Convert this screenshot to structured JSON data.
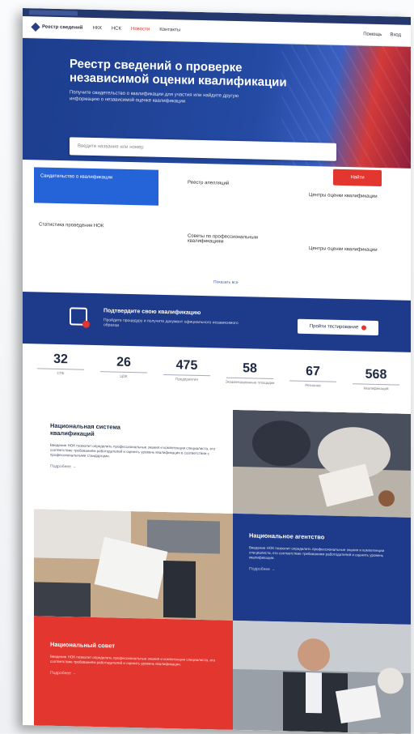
{
  "browser": {
    "tab_label": ""
  },
  "nav": {
    "logo_text": "Реестр сведений",
    "items": [
      "НКК",
      "НСК",
      "Новости",
      "Контакты"
    ],
    "right_items": [
      "Помощь",
      "Вход"
    ]
  },
  "hero": {
    "title": "Реестр сведений о проверке независимой оценки квалификации",
    "subtitle": "Получите свидетельство о квалификации для участия или найдите другую информацию о независимой оценке квалификации",
    "search_placeholder": "Введите название или номер",
    "search_button": "Найти"
  },
  "categories": {
    "items": [
      "Свидетельство о квалификации",
      "Реестр апелляций",
      "Центры оценки квалификации",
      "Статистика проведения НОК",
      "Советы по профессиональным квалификациям",
      "Центры оценки квалификации"
    ],
    "more_link": "Показать все"
  },
  "banner": {
    "title": "Подтвердите свою квалификацию",
    "subtitle": "Пройдите процедуру и получите документ официального независимого образца",
    "button": "Пройти тестирование"
  },
  "stats": [
    {
      "value": "32",
      "label": "СПК"
    },
    {
      "value": "26",
      "label": "ЦОК"
    },
    {
      "value": "475",
      "label": "Предприятия"
    },
    {
      "value": "58",
      "label": "Экзаменационные площадки"
    },
    {
      "value": "67",
      "label": "Регионов"
    },
    {
      "value": "568",
      "label": "Квалификаций"
    }
  ],
  "cards": {
    "nsk": {
      "title": "Национальная система квалификаций",
      "body": "Введение НОК позволит определить профессиональные знания и компетенции специалиста, его соответствие требованиям работодателей и оценить уровень квалификации в соответствии с профессиональными стандартами.",
      "more": "Подробнее →"
    },
    "agency": {
      "title": "Национальное агентство",
      "body": "Введение НОК позволит определить профессиональные знания и компетенции специалиста, его соответствие требованиям работодателей и оценить уровень квалификации.",
      "more": "Подробнее →"
    },
    "council": {
      "title": "Национальный совет",
      "body": "Введение НОК позволит определить профессиональные знания и компетенции специалиста, его соответствие требованиям работодателей и оценить уровень квалификации.",
      "more": "Подробнее →"
    }
  },
  "colors": {
    "brand_blue": "#1e3a8a",
    "accent_red": "#e2362f",
    "active_blue": "#2563d9"
  }
}
